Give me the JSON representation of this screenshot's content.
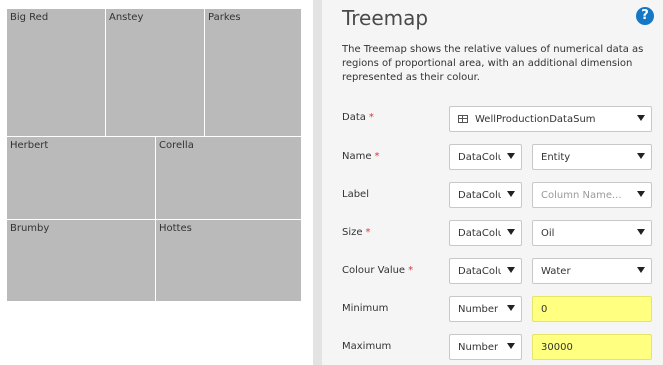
{
  "treemap": {
    "tiles": [
      {
        "label": "Big Red"
      },
      {
        "label": "Anstey"
      },
      {
        "label": "Parkes"
      },
      {
        "label": "Herbert"
      },
      {
        "label": "Corella"
      },
      {
        "label": "Brumby"
      },
      {
        "label": "Hottes"
      }
    ]
  },
  "panel": {
    "title": "Treemap",
    "help_icon": "help-icon",
    "description": "The Treemap shows the relative values of numerical data as regions of proportional area, with an additional dimension represented as their colour.",
    "required_marker": "*",
    "data": {
      "label": "Data",
      "required": true,
      "value": "WellProductionDataSum",
      "icon": "table-icon"
    },
    "name": {
      "label": "Name",
      "required": true,
      "type": "DataColu",
      "value": "Entity"
    },
    "label": {
      "label": "Label",
      "required": false,
      "type": "DataColu",
      "placeholder": "Column Name..."
    },
    "size": {
      "label": "Size",
      "required": true,
      "type": "DataColu",
      "value": "Oil"
    },
    "colour_value": {
      "label": "Colour Value",
      "required": true,
      "type": "DataColu",
      "value": "Water"
    },
    "minimum": {
      "label": "Minimum",
      "type": "Number",
      "value": "0"
    },
    "maximum": {
      "label": "Maximum",
      "type": "Number",
      "value": "30000"
    },
    "colors": {
      "tile": "#bababa",
      "highlight": "#ffff80",
      "accent": "#1478c7",
      "required": "#d9363e"
    }
  }
}
